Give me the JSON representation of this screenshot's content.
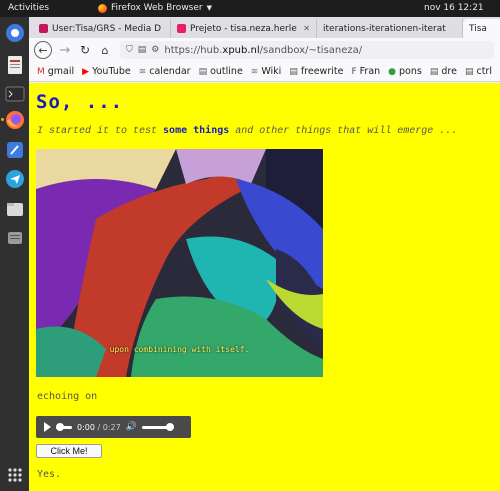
{
  "system": {
    "activities_label": "Activities",
    "app_name": "Firefox Web Browser",
    "clock": "nov 16  12:21"
  },
  "tabs": [
    {
      "label": "User:Tisa/GRS - Media D",
      "favicon_color": "#c2185b",
      "active": false
    },
    {
      "label": "Prejeto - tisa.neza.herle",
      "favicon_color": "#e91e63",
      "active": false
    },
    {
      "label": "iterations-iterationen-iterat",
      "favicon_color": "#333333",
      "active": false
    },
    {
      "label": "Tisa",
      "favicon_color": "#ffffff",
      "active": true
    }
  ],
  "url": {
    "prefix": "https://hub.",
    "host": "xpub.nl",
    "path": "/sandbox/~tisaneza/"
  },
  "bookmarks": [
    {
      "label": "gmail",
      "icon": "gmail-icon",
      "icon_glyph": "M",
      "color": "#d93025"
    },
    {
      "label": "YouTube",
      "icon": "youtube-icon",
      "icon_glyph": "▶",
      "color": "#ff0000"
    },
    {
      "label": "calendar",
      "icon": "calendar-icon",
      "icon_glyph": "≋",
      "color": "#777777"
    },
    {
      "label": "outline",
      "icon": "folder-icon",
      "icon_glyph": "▤",
      "color": "#555555"
    },
    {
      "label": "Wiki",
      "icon": "wiki-icon",
      "icon_glyph": "≋",
      "color": "#777777"
    },
    {
      "label": "freewrite",
      "icon": "folder-icon",
      "icon_glyph": "▤",
      "color": "#555555"
    },
    {
      "label": "Fran",
      "icon": "f-icon",
      "icon_glyph": "F",
      "color": "#555555"
    },
    {
      "label": "pons",
      "icon": "pons-icon",
      "icon_glyph": "●",
      "color": "#2e9e3e"
    },
    {
      "label": "dre",
      "icon": "folder-icon",
      "icon_glyph": "▤",
      "color": "#555555"
    },
    {
      "label": "ctrl",
      "icon": "folder-icon",
      "icon_glyph": "▤",
      "color": "#555555"
    }
  ],
  "page": {
    "heading": "So, ...",
    "intro_before": "I started it to test ",
    "intro_bold": "some things",
    "intro_after": " and other things that will emerge ...",
    "video_subtitle": "upon combinining with itself.",
    "echo_text": "echoing on",
    "audio": {
      "current_time": "0:00",
      "duration": "/ 0:27"
    },
    "button_label": "Click Me!",
    "footer_text": "Yes."
  },
  "colors": {
    "page_background": "#ffff00",
    "heading_blue": "#1a1ac8",
    "text_gray": "#555555"
  }
}
